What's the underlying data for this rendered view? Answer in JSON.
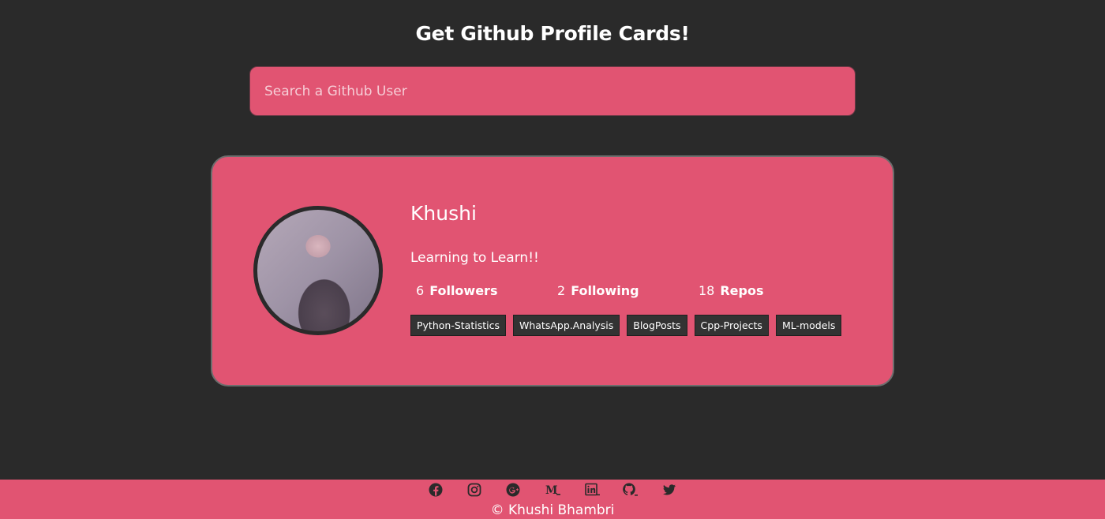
{
  "header": {
    "title": "Get Github Profile Cards!"
  },
  "search": {
    "placeholder": "Search a Github User",
    "value": ""
  },
  "profile": {
    "name": "Khushi",
    "bio": "Learning to Learn!!",
    "stats": [
      {
        "count": "6",
        "label": "Followers"
      },
      {
        "count": "2",
        "label": "Following"
      },
      {
        "count": "18",
        "label": "Repos"
      }
    ],
    "repos": [
      "Python-Statistics",
      "WhatsApp.Analysis",
      "BlogPosts",
      "Cpp-Projects",
      "ML-models"
    ]
  },
  "footer": {
    "social_icons": [
      "facebook-icon",
      "instagram-icon",
      "google-plus-icon",
      "medium-icon",
      "linkedin-icon",
      "github-icon",
      "twitter-icon"
    ],
    "copyright": "© Khushi Bhambri"
  },
  "colors": {
    "background": "#2a2a2a",
    "accent": "#e15472",
    "text": "#ffffff",
    "tag_background": "#333333"
  }
}
